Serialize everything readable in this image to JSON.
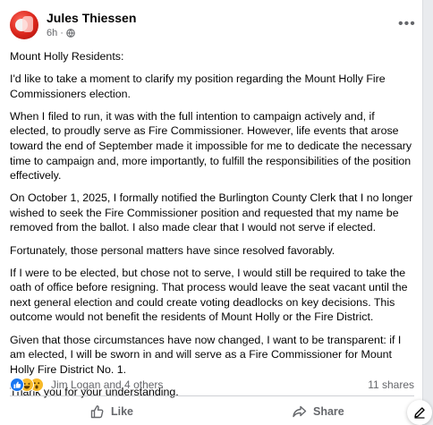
{
  "post": {
    "author": "Jules Thiessen",
    "time": "6h",
    "separator": "·",
    "paragraphs": [
      "Mount Holly Residents:",
      "I'd like to take a moment to clarify my position regarding the Mount Holly Fire Commissioners election.",
      "When I filed to run, it was with the full intention to campaign actively and, if elected, to proudly serve as Fire Commissioner.  However, life events that arose toward the end of September made it impossible for me to dedicate the necessary time to campaign and, more importantly, to fulfill the responsibilities of the position effectively.",
      "On October 1, 2025, I formally notified the Burlington County Clerk that I no longer wished to seek the Fire Commissioner position and requested that my name be removed from the ballot.  I also made clear that I would not serve if elected.",
      "Fortunately, those personal matters have since resolved favorably.",
      "If I were to be elected, but chose not to serve, I would still be required to take the oath of office before resigning.  That process would leave the seat vacant until the next general election and could create voting deadlocks on key decisions.  This outcome would not benefit the residents of Mount Holly or the Fire District.",
      "Given that those circumstances have now changed, I want to be transparent:  if I am elected, I will be sworn in and will serve as a Fire Commissioner for Mount Holly Fire District No. 1.",
      "Thank you for your understanding."
    ]
  },
  "reactions": {
    "reactors": "Jim Logan and 4 others",
    "shares": "11 shares",
    "icons": [
      "like-reaction-icon",
      "haha-reaction-icon",
      "wow-reaction-icon"
    ]
  },
  "actions": {
    "like_label": "Like",
    "share_label": "Share"
  },
  "colors": {
    "like_blue": "#1877f2",
    "reaction_yellow": "#f7b928",
    "secondary_text": "#65676b"
  }
}
